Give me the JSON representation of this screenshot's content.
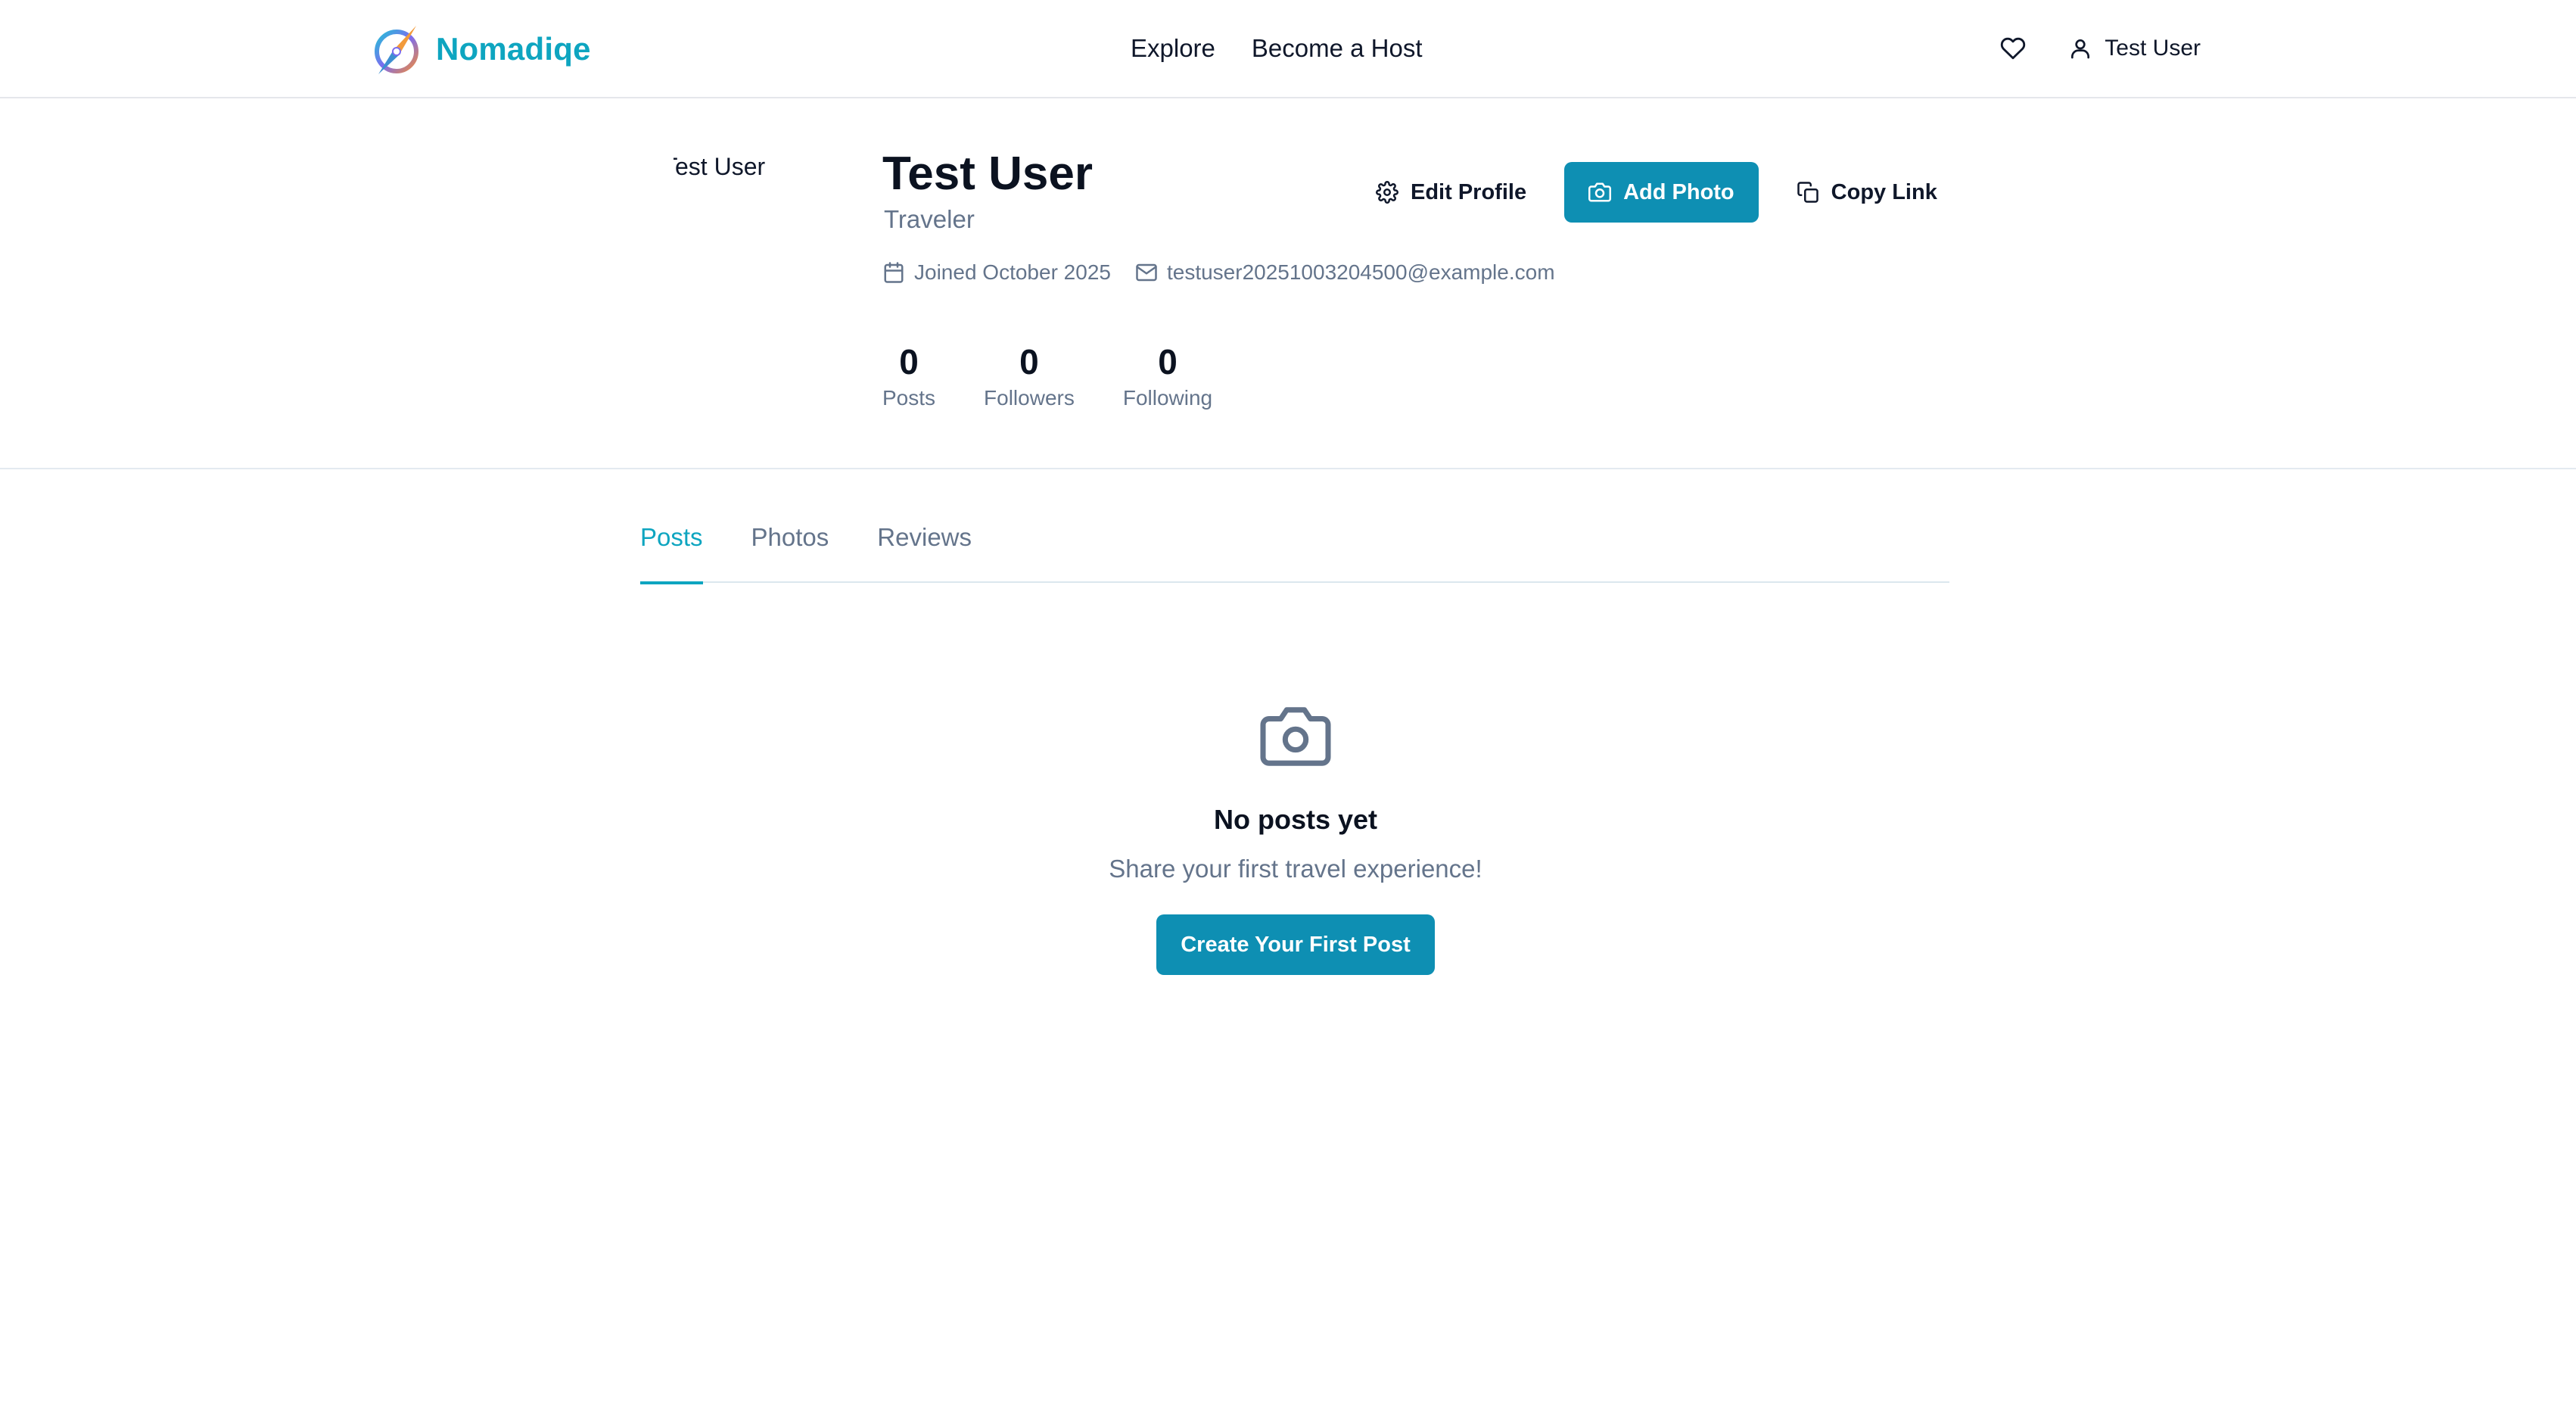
{
  "header": {
    "brand": "Nomadiqe",
    "nav": [
      "Explore",
      "Become a Host"
    ],
    "user_name": "Test User",
    "favorites_icon": "heart-icon",
    "user_icon": "user-icon"
  },
  "profile": {
    "avatar_alt": "Test User",
    "name": "Test User",
    "role": "Traveler",
    "joined": "Joined October 2025",
    "email": "testuser20251003204500@example.com",
    "stats": [
      {
        "value": "0",
        "label": "Posts"
      },
      {
        "value": "0",
        "label": "Followers"
      },
      {
        "value": "0",
        "label": "Following"
      }
    ],
    "actions": {
      "edit": "Edit Profile",
      "add_photo": "Add Photo",
      "copy_link": "Copy Link"
    }
  },
  "tabs": [
    {
      "label": "Posts",
      "active": true
    },
    {
      "label": "Photos",
      "active": false
    },
    {
      "label": "Reviews",
      "active": false
    }
  ],
  "empty_state": {
    "icon": "camera-icon",
    "title": "No posts yet",
    "subtitle": "Share your first travel experience!",
    "cta": "Create Your First Post"
  },
  "colors": {
    "accent": "#0ea5c0",
    "button": "#0e8fb3",
    "muted_text": "#64748b",
    "border": "#e5e7eb"
  }
}
